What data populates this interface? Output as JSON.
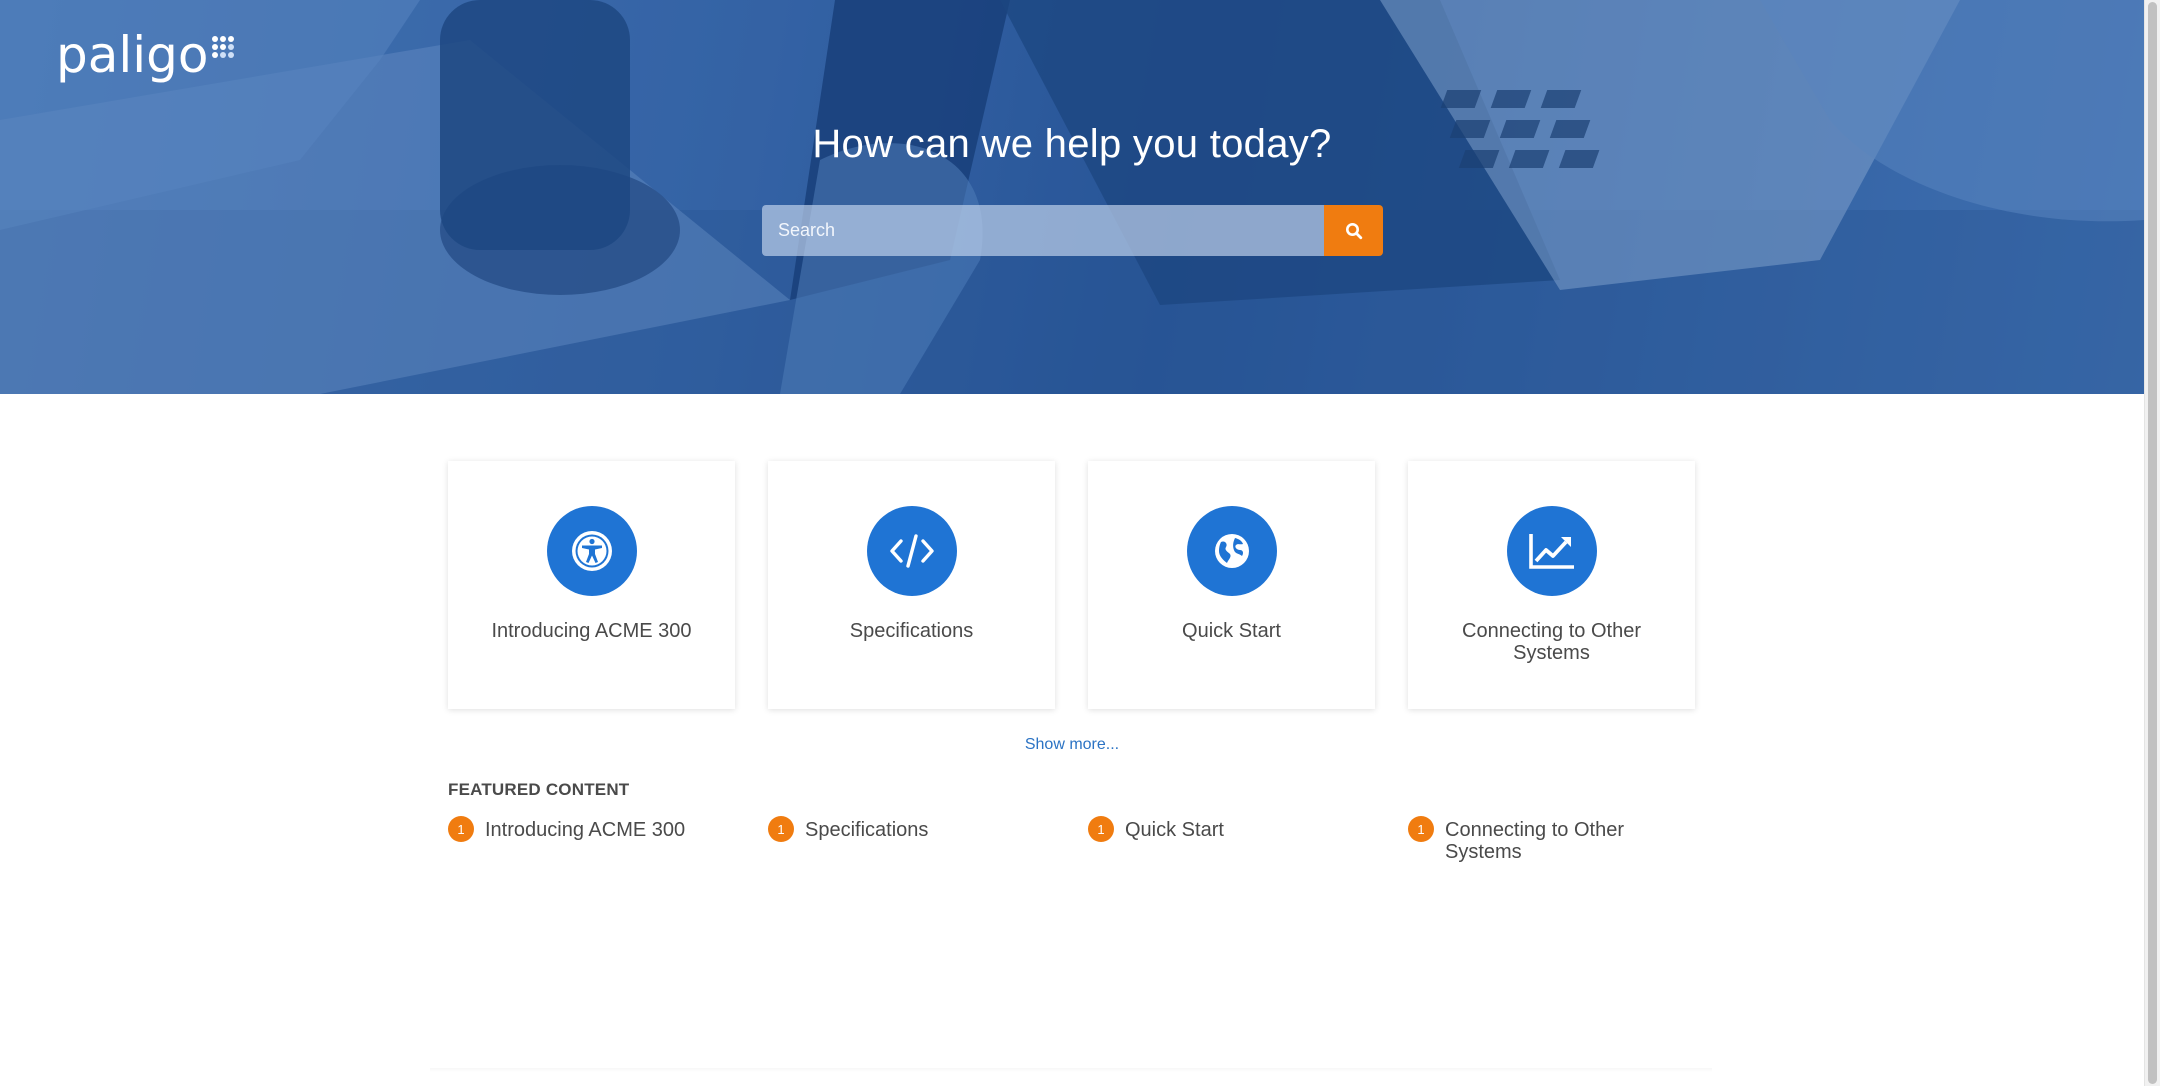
{
  "brand": {
    "logo_text": "paligo",
    "colors": {
      "hero_blue": "#3c6aad",
      "accent_orange": "#f07c10",
      "icon_blue": "#1f74d4",
      "link_blue": "#2b73c4",
      "text_gray": "#4a4a4a"
    }
  },
  "hero": {
    "title": "How can we help you today?",
    "search": {
      "placeholder": "Search",
      "value": "",
      "button_icon": "search-icon"
    }
  },
  "cards": [
    {
      "label": "Introducing ACME 300",
      "icon": "accessibility-icon"
    },
    {
      "label": "Specifications",
      "icon": "code-icon"
    },
    {
      "label": "Quick Start",
      "icon": "globe-icon"
    },
    {
      "label": "Connecting to Other Systems",
      "icon": "line-chart-icon"
    }
  ],
  "show_more": "Show more...",
  "featured": {
    "heading": "FEATURED CONTENT",
    "items": [
      {
        "badge": "1",
        "label": "Introducing ACME 300"
      },
      {
        "badge": "1",
        "label": "Specifications"
      },
      {
        "badge": "1",
        "label": "Quick Start"
      },
      {
        "badge": "1",
        "label": "Connecting to Other Systems"
      }
    ]
  }
}
